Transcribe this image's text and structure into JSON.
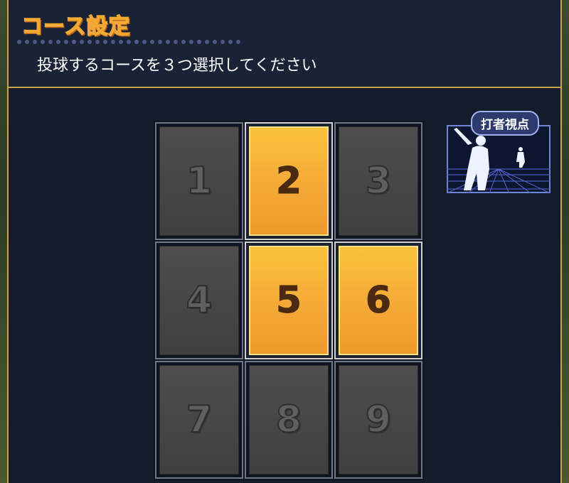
{
  "header": {
    "title": "コース設定",
    "instruction": "投球するコースを３つ選択してください"
  },
  "course_grid": {
    "cells": [
      {
        "label": "1",
        "selected": false
      },
      {
        "label": "2",
        "selected": true
      },
      {
        "label": "3",
        "selected": false
      },
      {
        "label": "4",
        "selected": false
      },
      {
        "label": "5",
        "selected": true
      },
      {
        "label": "6",
        "selected": true
      },
      {
        "label": "7",
        "selected": false
      },
      {
        "label": "8",
        "selected": false
      },
      {
        "label": "9",
        "selected": false
      }
    ]
  },
  "view_toggle": {
    "label": "打者視点",
    "icon": "batter-view-icon"
  },
  "colors": {
    "panel_bg": "#141b2b",
    "border_gold": "#c9a24a",
    "selected_orange": "#f5a936",
    "unselected_gray": "#4a4a4a"
  }
}
